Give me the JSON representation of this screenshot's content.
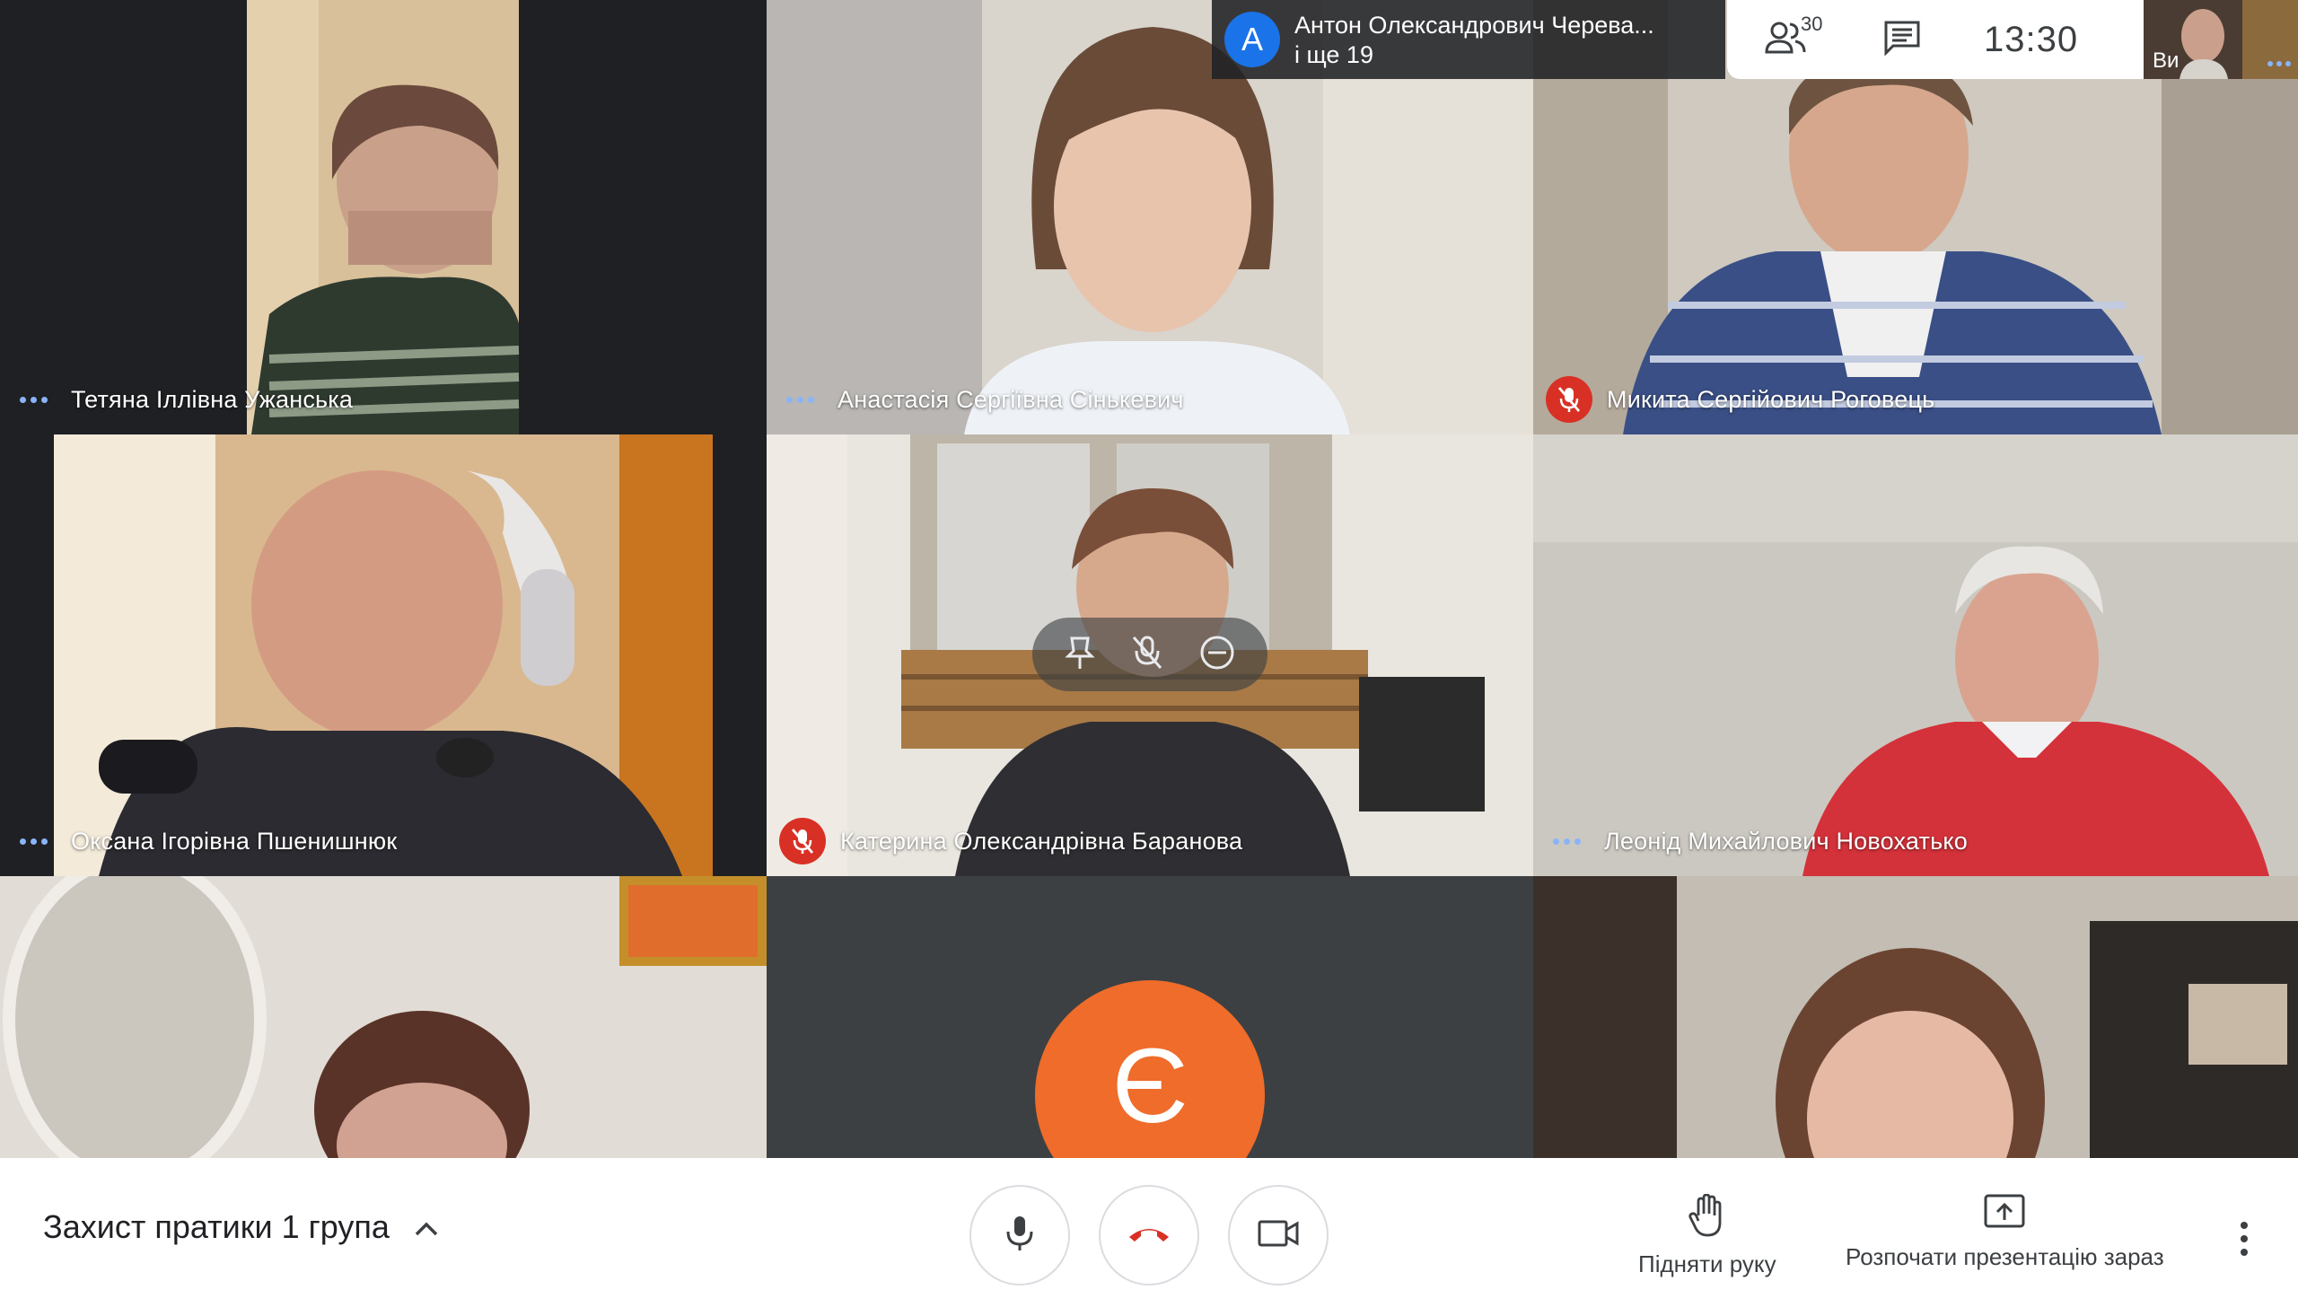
{
  "presenter": {
    "avatar_letter": "A",
    "name": "Антон Олександрович Черева...",
    "others": "і ще 19"
  },
  "topbar": {
    "participants_icon": "people-icon",
    "participants_count": "30",
    "chat_icon": "chat-icon",
    "clock": "13:30"
  },
  "self_view": {
    "label": "Ви"
  },
  "tiles": [
    {
      "name": "Тетяна Іллівна Ужанська",
      "state": "active-dots"
    },
    {
      "name": "Анастасія Сергіївна Сінькевич",
      "state": "active-dots"
    },
    {
      "name": "Микита Сергійович Роговець",
      "state": "muted"
    },
    {
      "name": "Оксана Ігорівна Пшенишнюк",
      "state": "active-dots"
    },
    {
      "name": "Катерина Олександрівна Баранова",
      "state": "muted"
    },
    {
      "name": "Леонід Михайлович Новохатько",
      "state": "active-dots"
    }
  ],
  "avatar_tile": {
    "letter": "Є",
    "color": "#ef6c2a"
  },
  "tile_controls": [
    "pin-icon",
    "mic-off-icon",
    "remove-icon"
  ],
  "bottombar": {
    "meeting_title": "Захист пратики 1 група",
    "raise_hand": "Підняти руку",
    "present_now": "Розпочати презентацію зараз"
  },
  "colors": {
    "mute_red": "#d93025",
    "accent_blue": "#1a73e8",
    "activity_dots": "#8ab4f8",
    "end_call_red": "#d93025"
  }
}
